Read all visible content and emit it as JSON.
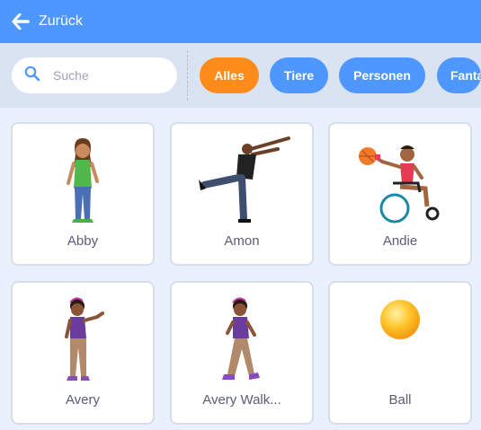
{
  "header": {
    "back_label": "Zurück"
  },
  "search": {
    "placeholder": "Suche"
  },
  "tags": [
    {
      "label": "Alles",
      "active": true
    },
    {
      "label": "Tiere",
      "active": false
    },
    {
      "label": "Personen",
      "active": false
    },
    {
      "label": "Fantasie",
      "active": false
    }
  ],
  "sprites": [
    {
      "name": "Abby"
    },
    {
      "name": "Amon"
    },
    {
      "name": "Andie"
    },
    {
      "name": "Avery"
    },
    {
      "name": "Avery Walk..."
    },
    {
      "name": "Ball"
    }
  ],
  "colors": {
    "header": "#4d97ff",
    "tag": "#4d97ff",
    "tag_active": "#ff8c1a",
    "background": "#e9f1fc",
    "filterbar": "#d9e3f2"
  }
}
